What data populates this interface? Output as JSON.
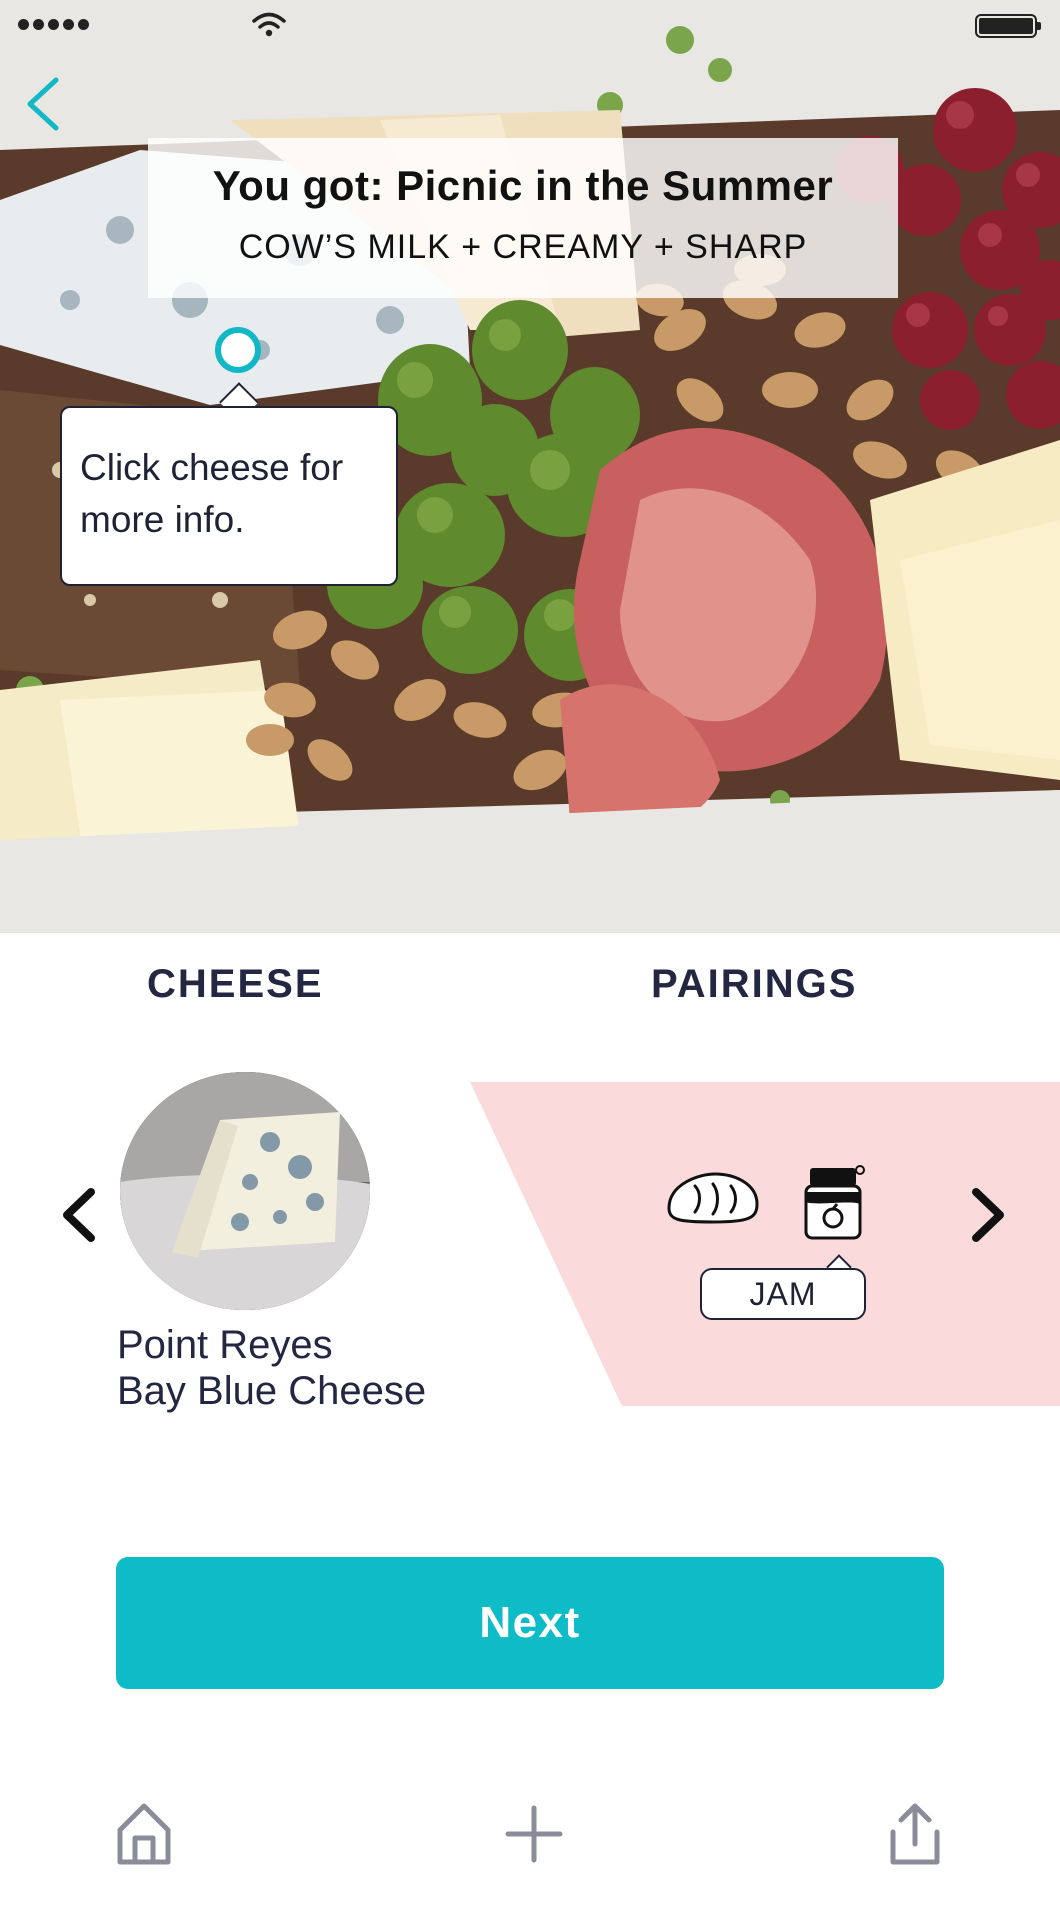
{
  "status_bar": {
    "signal_icon": "signal-dots-icon",
    "wifi_icon": "wifi-icon",
    "battery_icon": "battery-icon"
  },
  "header": {
    "back_icon": "chevron-left-icon",
    "result_title": "You got: Picnic in the Summer",
    "result_subtitle": "COW’S MILK + CREAMY + SHARP"
  },
  "hotspot": {
    "tooltip": "Click cheese for more info."
  },
  "tabs": [
    {
      "label": "CHEESE"
    },
    {
      "label": "PAIRINGS"
    }
  ],
  "cheese": {
    "name_line1": "Point Reyes",
    "name_line2": "Bay Blue Cheese"
  },
  "pairings": {
    "icons": [
      "bread-icon",
      "jam-jar-icon"
    ],
    "selected_label": "JAM"
  },
  "actions": {
    "next_label": "Next"
  },
  "bottom_nav": {
    "items": [
      "home-icon",
      "add-icon",
      "share-icon"
    ]
  },
  "colors": {
    "accent": "#0ebcc8",
    "text_dark": "#242742",
    "pairings_bg": "#fadadb"
  }
}
